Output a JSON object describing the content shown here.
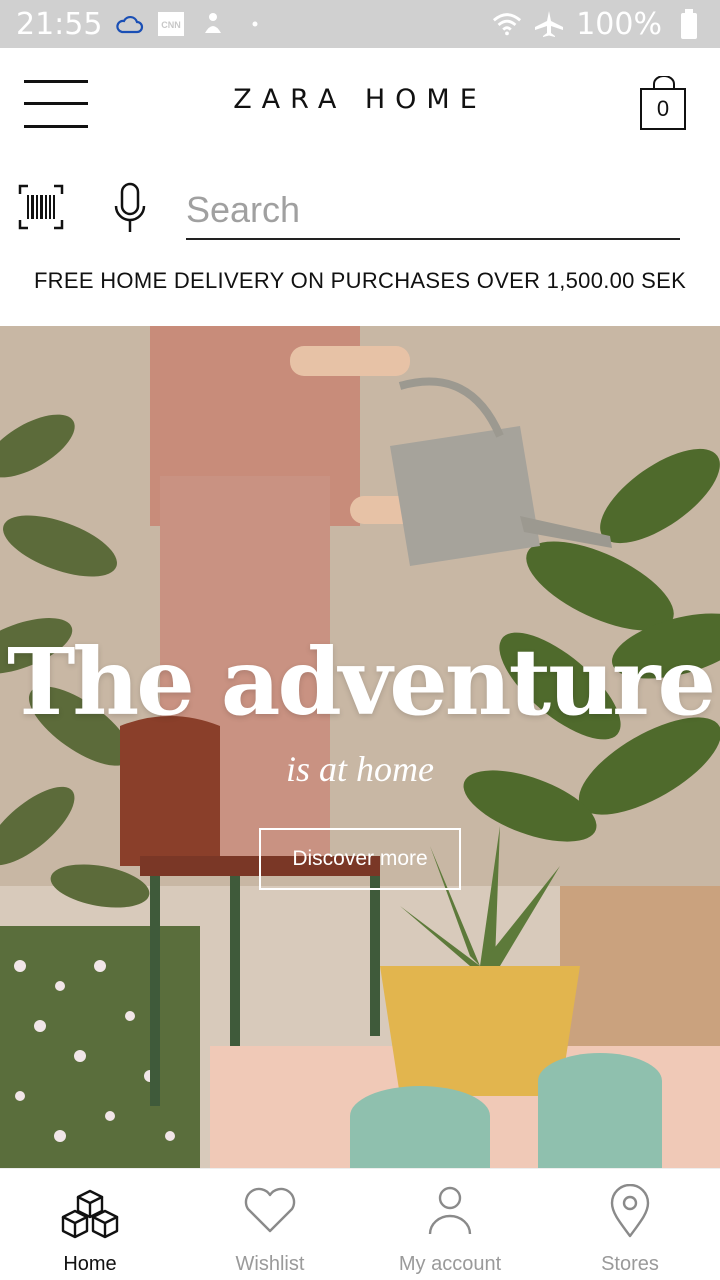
{
  "status_bar": {
    "time": "21:55",
    "battery": "100%",
    "icons": [
      "cloud-icon",
      "cnn-icon",
      "notification-icon",
      "dot-icon",
      "wifi-icon",
      "airplane-icon",
      "battery-icon"
    ]
  },
  "header": {
    "logo": "ZARA HOME",
    "cart_count": "0"
  },
  "search": {
    "placeholder": "Search"
  },
  "promo": {
    "delivery_text": "FREE HOME DELIVERY ON PURCHASES OVER 1,500.00 SEK"
  },
  "hero": {
    "title": "The adventure",
    "subtitle": "is at home",
    "cta_label": "Discover more"
  },
  "bottom_nav": {
    "items": [
      {
        "label": "Home",
        "icon": "cubes-icon",
        "active": true
      },
      {
        "label": "Wishlist",
        "icon": "heart-icon",
        "active": false
      },
      {
        "label": "My account",
        "icon": "person-icon",
        "active": false
      },
      {
        "label": "Stores",
        "icon": "location-pin-icon",
        "active": false
      }
    ]
  },
  "colors": {
    "status_bar_bg": "#d0d0d0",
    "text_primary": "#111111",
    "text_muted": "#9a9a9a"
  }
}
